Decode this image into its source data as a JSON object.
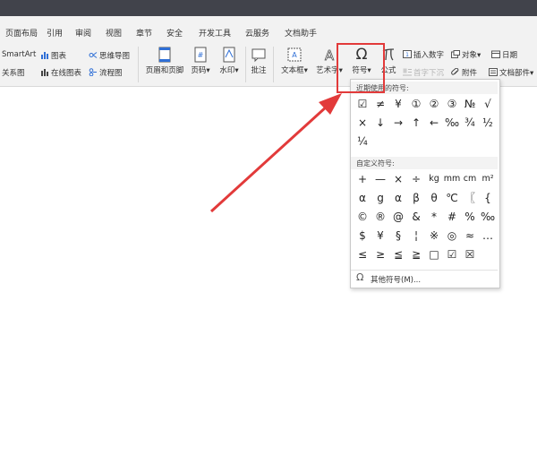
{
  "menu": {
    "tabs": [
      "页面布局",
      "引用",
      "审阅",
      "视图",
      "章节",
      "安全",
      "开发工具",
      "云服务",
      "文档助手"
    ]
  },
  "ribbon": {
    "smartart": "SmartArt",
    "chart": "图表",
    "mindmap": "思维导图",
    "relation": "关系图",
    "online_chart": "在线图表",
    "flowchart": "流程图",
    "header_footer": "页眉和页脚",
    "page_number": "页码",
    "watermark": "水印",
    "comment": "批注",
    "textbox": "文本框",
    "wordart": "艺术字",
    "symbol": "符号",
    "formula": "公式",
    "insert_number": "插入数字",
    "object": "对象",
    "date": "日期",
    "first_letter": "首字下沉",
    "attachment": "附件",
    "doc_parts": "文档部件",
    "dropdown_mark": "▾"
  },
  "popup": {
    "recent_title": "近期使用的符号:",
    "recent_symbols": [
      "☑",
      "≠",
      "¥",
      "①",
      "②",
      "③",
      "№",
      "√",
      "×",
      "↓",
      "→",
      "↑",
      "←",
      "‰",
      "¾",
      "½",
      "¼"
    ],
    "custom_title": "自定义符号:",
    "custom_symbols": [
      "+",
      "—",
      "×",
      "÷",
      "kg",
      "mm",
      "cm",
      "m²",
      "α",
      "g",
      "α",
      "β",
      "θ",
      "℃",
      "〖",
      "{",
      "©",
      "®",
      "@",
      "&",
      "*",
      "#",
      "%",
      "‰",
      "$",
      "¥",
      "§",
      "¦",
      "※",
      "◎",
      "≈",
      "…",
      "≤",
      "≥",
      "≦",
      "≧",
      "□",
      "☑",
      "☒"
    ],
    "more_symbols": "其他符号(M)...",
    "omega": "Ω"
  },
  "colors": {
    "highlight": "#e23a3a",
    "arrow": "#e23a3a",
    "titlebar": "#41434b",
    "ribbon_bg": "#f2f2f2"
  }
}
